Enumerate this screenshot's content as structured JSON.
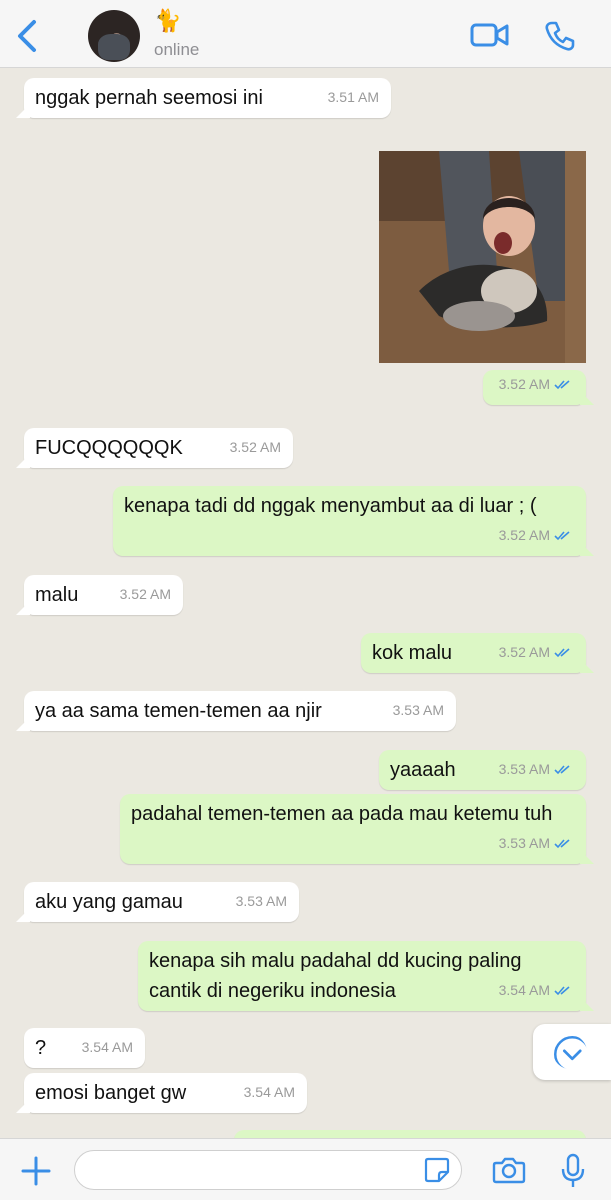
{
  "header": {
    "contact_emoji": "🐈",
    "status": "online"
  },
  "messages": [
    {
      "dir": "in",
      "text": "nggak pernah seemosi ini",
      "time": "3.51 AM"
    },
    {
      "dir": "out",
      "type": "image",
      "time": "3.52 AM",
      "read": true
    },
    {
      "dir": "in",
      "text": "FUCQQQQQQK",
      "time": "3.52 AM"
    },
    {
      "dir": "out",
      "text": "kenapa tadi dd nggak menyambut aa di luar ; (",
      "time": "3.52 AM",
      "read": true
    },
    {
      "dir": "in",
      "text": "malu",
      "time": "3.52 AM"
    },
    {
      "dir": "out",
      "text": "kok malu",
      "time": "3.52 AM",
      "read": true
    },
    {
      "dir": "in",
      "text": "ya aa sama temen-temen aa njir",
      "time": "3.53 AM"
    },
    {
      "dir": "out",
      "text": "yaaaah",
      "time": "3.53 AM",
      "read": true
    },
    {
      "dir": "out",
      "text": "padahal temen-temen aa pada mau ketemu tuh",
      "time": "3.53 AM",
      "read": true
    },
    {
      "dir": "in",
      "text": "aku yang gamau",
      "time": "3.53 AM"
    },
    {
      "dir": "out",
      "text": "kenapa sih malu padahal dd kucing paling cantik di negeriku indonesia",
      "time": "3.54 AM",
      "read": true
    },
    {
      "dir": "in",
      "text": "?",
      "time": "3.54 AM"
    },
    {
      "dir": "in",
      "text": "emosi banget gw",
      "time": "3.54 AM"
    }
  ],
  "composer": {
    "placeholder": ""
  },
  "colors": {
    "accent": "#3a8ee6",
    "background": "#ebe8e1",
    "incoming_bubble": "#ffffff",
    "outgoing_bubble": "#dcf7c5",
    "timestamp": "#9a9a9a"
  }
}
